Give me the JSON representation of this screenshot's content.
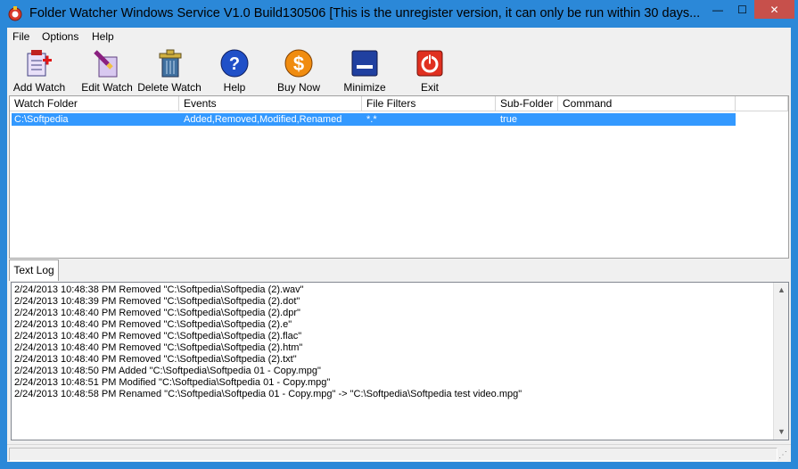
{
  "window": {
    "title": "Folder Watcher Windows Service V1.0 Build130506 [This is the unregister version, it can only be run within 30 days...",
    "minimize_glyph": "—",
    "maximize_glyph": "☐",
    "close_glyph": "✕"
  },
  "menu": {
    "items": [
      {
        "label": "File"
      },
      {
        "label": "Options"
      },
      {
        "label": "Help"
      }
    ]
  },
  "toolbar": {
    "buttons": [
      {
        "label": "Add Watch",
        "icon": "add-watch-icon"
      },
      {
        "label": "Edit Watch",
        "icon": "edit-watch-icon"
      },
      {
        "label": "Delete Watch",
        "icon": "delete-watch-icon"
      },
      {
        "label": "Help",
        "icon": "help-icon"
      },
      {
        "label": "Buy Now",
        "icon": "buy-now-icon"
      },
      {
        "label": "Minimize",
        "icon": "minimize-icon"
      },
      {
        "label": "Exit",
        "icon": "exit-icon"
      }
    ]
  },
  "watch_list": {
    "columns": [
      "Watch Folder",
      "Events",
      "File Filters",
      "Sub-Folder",
      "Command"
    ],
    "rows": [
      {
        "watch_folder": "C:\\Softpedia",
        "events": "Added,Removed,Modified,Renamed",
        "file_filters": "*.*",
        "sub_folder": "true",
        "command": ""
      }
    ]
  },
  "tabs": {
    "text_log": "Text Log"
  },
  "log": {
    "lines": [
      "2/24/2013 10:48:38 PM Removed \"C:\\Softpedia\\Softpedia (2).wav\"",
      "2/24/2013 10:48:39 PM Removed \"C:\\Softpedia\\Softpedia (2).dot\"",
      "2/24/2013 10:48:40 PM Removed \"C:\\Softpedia\\Softpedia (2).dpr\"",
      "2/24/2013 10:48:40 PM Removed \"C:\\Softpedia\\Softpedia (2).e\"",
      "2/24/2013 10:48:40 PM Removed \"C:\\Softpedia\\Softpedia (2).flac\"",
      "2/24/2013 10:48:40 PM Removed \"C:\\Softpedia\\Softpedia (2).htm\"",
      "2/24/2013 10:48:40 PM Removed \"C:\\Softpedia\\Softpedia (2).txt\"",
      "2/24/2013 10:48:50 PM Added \"C:\\Softpedia\\Softpedia 01 - Copy.mpg\"",
      "2/24/2013 10:48:51 PM Modified \"C:\\Softpedia\\Softpedia 01 - Copy.mpg\"",
      "2/24/2013 10:48:58 PM Renamed \"C:\\Softpedia\\Softpedia 01 - Copy.mpg\" -> \"C:\\Softpedia\\Softpedia test video.mpg\""
    ]
  },
  "scrollbar": {
    "up_glyph": "▲",
    "down_glyph": "▼"
  },
  "statusbar": {
    "grip_glyph": "⋰"
  },
  "colors": {
    "titlebar": "#2b88d8",
    "selection": "#3399ff",
    "close_button": "#c7504b"
  }
}
